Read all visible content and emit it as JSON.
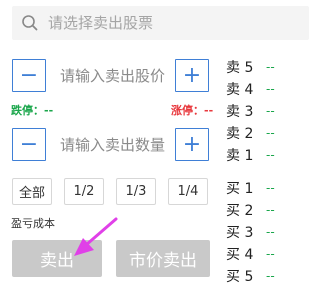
{
  "search": {
    "placeholder": "请选择卖出股票"
  },
  "price": {
    "minus": "−",
    "plus": "+",
    "placeholder": "请输入卖出股价"
  },
  "limits": {
    "down_label": "跌停：",
    "down_value": "--",
    "up_label": "涨停：",
    "up_value": "--"
  },
  "quantity": {
    "minus": "−",
    "plus": "+",
    "placeholder": "请输入卖出数量"
  },
  "ratios": [
    "全部",
    "1/2",
    "1/3",
    "1/4"
  ],
  "profit_loss_label": "盈亏成本",
  "actions": {
    "sell": "卖出",
    "market_sell": "市价卖出"
  },
  "order_book": {
    "asks": [
      {
        "label": "卖 5",
        "value": "--"
      },
      {
        "label": "卖 4",
        "value": "--"
      },
      {
        "label": "卖 3",
        "value": "--"
      },
      {
        "label": "卖 2",
        "value": "--"
      },
      {
        "label": "卖 1",
        "value": "--"
      }
    ],
    "bids": [
      {
        "label": "买 1",
        "value": "--"
      },
      {
        "label": "买 2",
        "value": "--"
      },
      {
        "label": "买 3",
        "value": "--"
      },
      {
        "label": "买 4",
        "value": "--"
      },
      {
        "label": "买 5",
        "value": "--"
      }
    ]
  },
  "colors": {
    "accent_blue": "#3f7fd6",
    "limit_down_green": "#1aa64b",
    "limit_up_red": "#e8383d",
    "disabled_button": "#c9c9c9",
    "annotation_arrow": "#e040e8"
  }
}
